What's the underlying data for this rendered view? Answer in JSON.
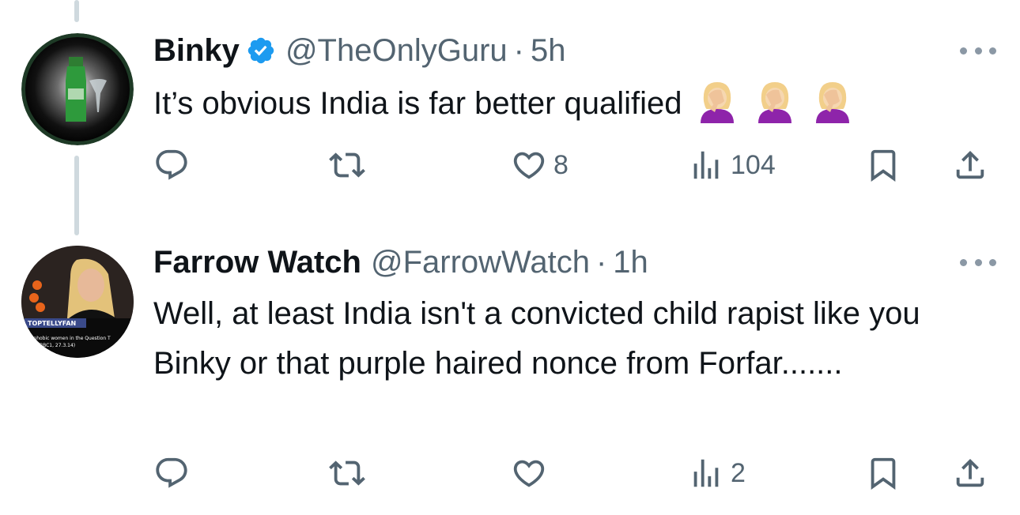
{
  "tweets": [
    {
      "display_name": "Binky",
      "verified": true,
      "handle": "@TheOnlyGuru",
      "separator": "·",
      "time": "5h",
      "text": "It’s obvious India is far better qualified",
      "emojis": [
        "woman-facepalming-emoji",
        "woman-facepalming-emoji",
        "woman-facepalming-emoji"
      ],
      "actions": {
        "reply": "",
        "repost": "",
        "like": "8",
        "views": "104"
      }
    },
    {
      "display_name": "Farrow Watch",
      "verified": false,
      "handle": "@FarrowWatch",
      "separator": "·",
      "time": "1h",
      "text": "Well, at least India isn't a convicted child rapist like you Binky or that purple haired nonce from Forfar.......",
      "avatar_caption": "TOPTELLYFAN",
      "avatar_subcaption": "...ophobic women in the Question T... ...ce (BBC1, 27.3.14)",
      "actions": {
        "reply": "",
        "repost": "",
        "like": "",
        "views": "2"
      }
    }
  ],
  "colors": {
    "text": "#0f1419",
    "secondary": "#536471",
    "verified": "#1d9bf0",
    "thread_line": "#cfd9de"
  },
  "icons": [
    "reply-icon",
    "repost-icon",
    "like-icon",
    "views-icon",
    "bookmark-icon",
    "share-icon",
    "more-icon",
    "verified-badge-icon"
  ]
}
